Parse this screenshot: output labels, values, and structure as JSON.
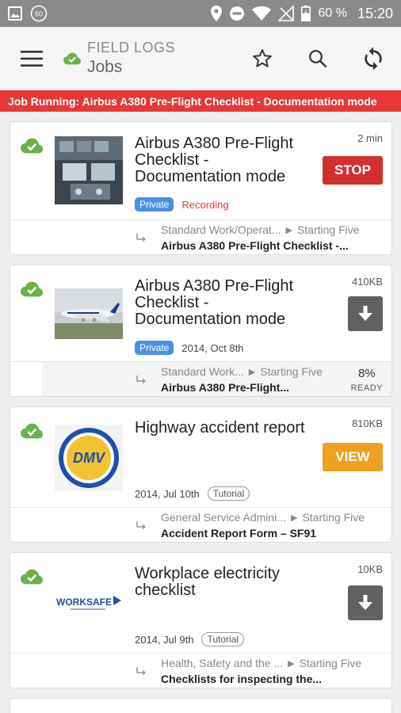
{
  "status_bar": {
    "notification_count": "60",
    "battery": "60 %",
    "time": "15:20"
  },
  "app_bar": {
    "kicker": "FIELD LOGS",
    "title": "Jobs"
  },
  "banner": {
    "text": "Job Running: Airbus A380 Pre-Flight Checklist - Documentation mode"
  },
  "jobs": [
    {
      "title": "Airbus A380 Pre-Flight Checklist - Documentation mode",
      "meta": "2 min",
      "badge": "Private",
      "status": "Recording",
      "action": "STOP",
      "path_first": "Standard Work/Operat...",
      "path_second": "Starting Five",
      "form": "Airbus A380 Pre-Flight Checklist -..."
    },
    {
      "title": "Airbus A380 Pre-Flight Checklist - Documentation mode",
      "meta": "410KB",
      "badge": "Private",
      "date": "2014, Oct 8th",
      "path_first": "Standard Work...",
      "path_second": "Starting Five",
      "form": "Airbus A380 Pre-Flight...",
      "progress": "8%",
      "progress_label": "READY"
    },
    {
      "title": "Highway accident report",
      "meta": "810KB",
      "date": "2014, Jul 10th",
      "tag": "Tutorial",
      "action": "VIEW",
      "path_first": "General Service Admini...",
      "path_second": "Starting Five",
      "form": "Accident Report Form – SF91"
    },
    {
      "title": "Workplace electricity checklist",
      "meta": "10KB",
      "date": "2014, Jul 9th",
      "tag": "Tutorial",
      "path_first": "Health, Safety and the ...",
      "path_second": "Starting Five",
      "form": "Checklists for inspecting the..."
    }
  ],
  "logos": {
    "dmv_text": "DMV",
    "worksafe_text": "WORKSAFE"
  },
  "colors": {
    "banner": "#e53935",
    "stop": "#d32f2f",
    "view": "#f0a020",
    "private_badge": "#4a90e2",
    "sync_cloud": "#6ab04c"
  }
}
